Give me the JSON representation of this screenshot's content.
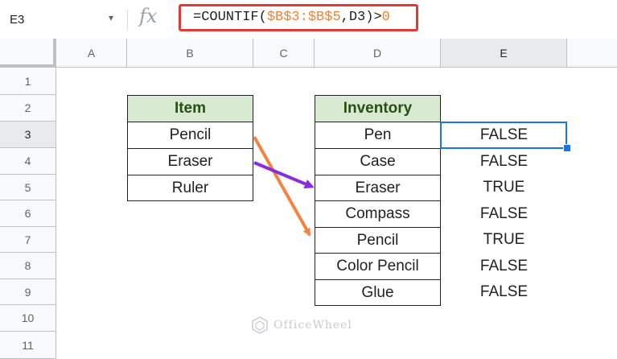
{
  "formula_bar": {
    "name_box": "E3",
    "caret": "▾",
    "fx": "fx",
    "formula_prefix": "=COUNTIF(",
    "formula_ref": "$B$3:$B$5",
    "formula_mid": ",D3)>",
    "formula_zero": "0"
  },
  "columns": [
    "A",
    "B",
    "C",
    "D",
    "E"
  ],
  "rows": [
    "1",
    "2",
    "3",
    "4",
    "5",
    "6",
    "7",
    "8",
    "9",
    "10",
    "11"
  ],
  "item_table": {
    "header": "Item",
    "values": [
      "Pencil",
      "Eraser",
      "Ruler"
    ]
  },
  "inventory_table": {
    "header": "Inventory",
    "values": [
      "Pen",
      "Case",
      "Eraser",
      "Compass",
      "Pencil",
      "Color Pencil",
      "Glue"
    ]
  },
  "results": [
    "FALSE",
    "FALSE",
    "TRUE",
    "FALSE",
    "TRUE",
    "FALSE",
    "FALSE"
  ],
  "arrows": {
    "orange": "#f4833f",
    "purple": "#8a2be2"
  },
  "watermark": "OfficeWheel"
}
